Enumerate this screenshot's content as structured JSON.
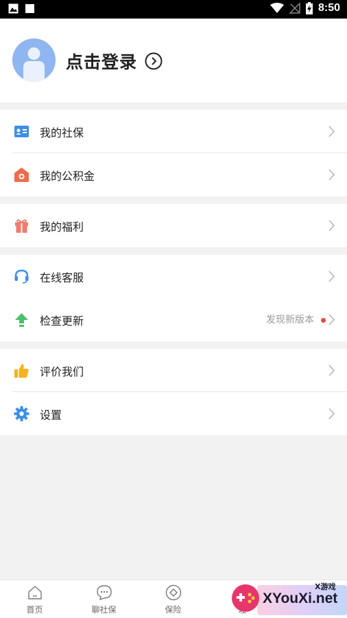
{
  "status_bar": {
    "time": "8:50"
  },
  "profile": {
    "login_label": "点击登录"
  },
  "menu": {
    "social_security": "我的社保",
    "housing_fund": "我的公积金",
    "welfare": "我的福利",
    "customer_service": "在线客服",
    "check_update": "检查更新",
    "update_note": "发现新版本",
    "rate_us": "评价我们",
    "settings": "设置"
  },
  "tabs": [
    "首页",
    "聊社保",
    "保险",
    "理"
  ],
  "watermark": {
    "brand": "XYouXi.net",
    "tag": "X游戏"
  },
  "colors": {
    "social_security_icon": "#3d8fe6",
    "housing_fund_icon": "#ef6b4e",
    "welfare_icon": "#ee7b6e",
    "customer_service_icon": "#3d8fe6",
    "update_icon": "#4cbf6b",
    "rate_icon": "#f5b21c",
    "settings_icon": "#3d8fe6",
    "update_dot": "#e74c3c"
  }
}
